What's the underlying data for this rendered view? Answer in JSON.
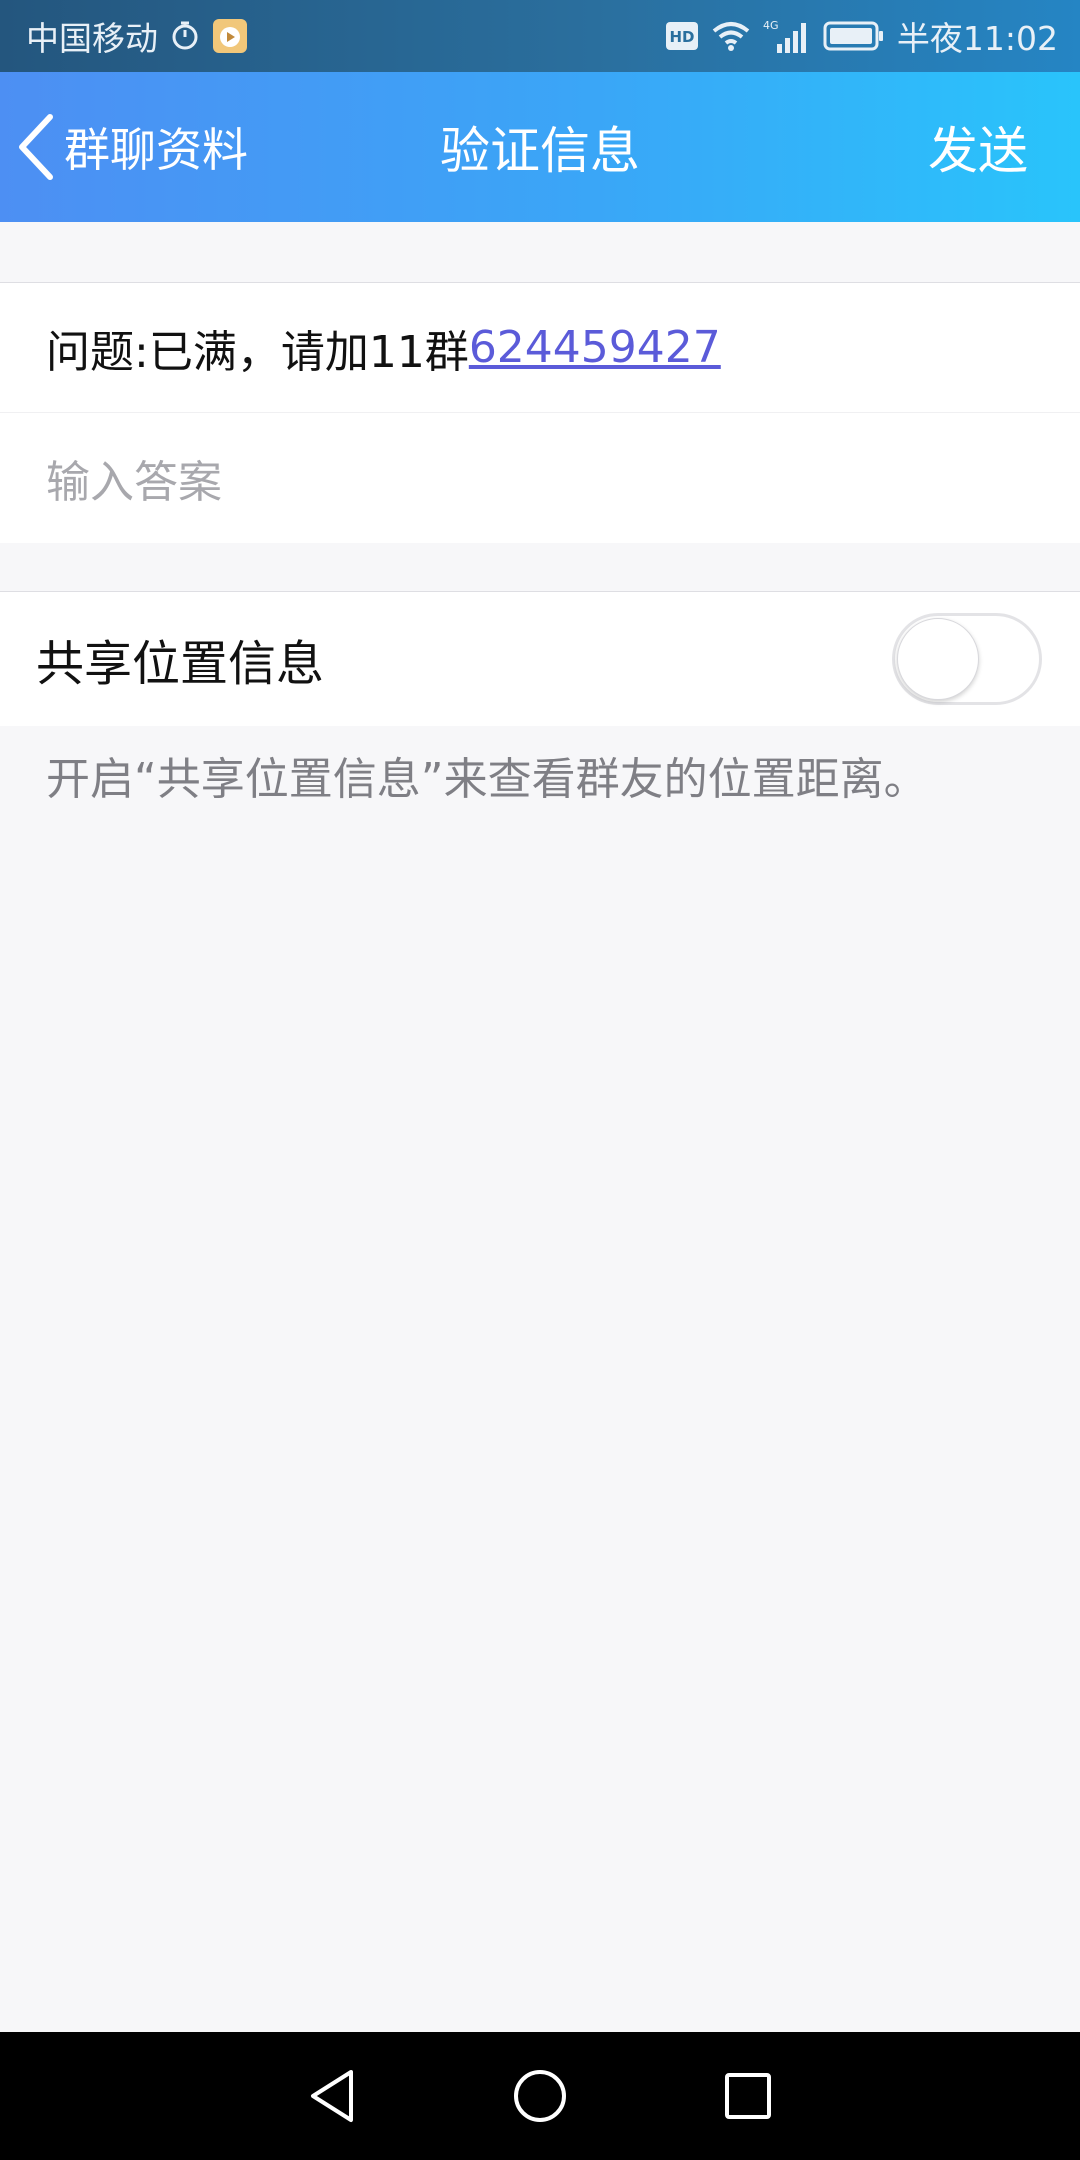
{
  "status_bar": {
    "carrier": "中国移动",
    "hd_badge": "HD",
    "network_type": "4G",
    "time": "半夜11:02",
    "icons": [
      "alarm-icon",
      "app-notification-icon",
      "hd-icon",
      "wifi-icon",
      "signal-icon",
      "battery-icon"
    ]
  },
  "nav": {
    "back_label": "群聊资料",
    "title": "验证信息",
    "action_label": "发送",
    "icons": [
      "back-chevron-icon"
    ]
  },
  "question": {
    "prefix": "问题:已满，请加11群",
    "link_text": "624459427"
  },
  "answer": {
    "placeholder": "输入答案",
    "value": ""
  },
  "location": {
    "label": "共享位置信息",
    "enabled": false,
    "hint": "开启“共享位置信息”来查看群友的位置距离。"
  },
  "system_nav": {
    "icons": [
      "back-triangle-icon",
      "home-circle-icon",
      "recents-square-icon"
    ]
  },
  "colors": {
    "nav_gradient_start": "#4d8ff3",
    "nav_gradient_end": "#29c4fb",
    "link": "#5b5bd9",
    "placeholder": "#a8a8ad",
    "page_background": "#f7f7f9"
  }
}
